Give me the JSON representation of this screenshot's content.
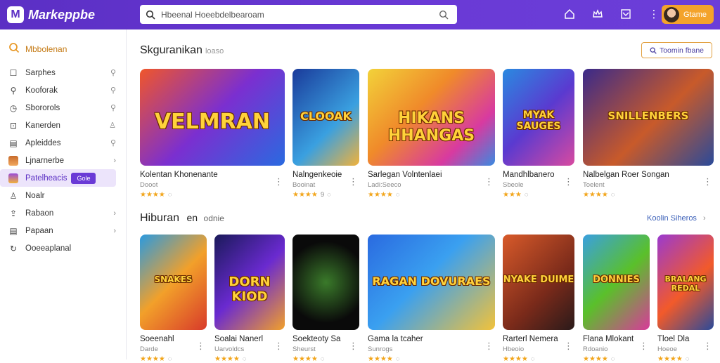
{
  "app": {
    "name": "Markeppbe"
  },
  "search": {
    "value": "Hbeenal Hoeebdelbearoam"
  },
  "header": {
    "user_label": "Gtame"
  },
  "sidebar": {
    "heading": "Mbbolenan",
    "items": [
      {
        "label": "Sarphes",
        "icon": "square-icon",
        "trailing": "pin"
      },
      {
        "label": "Kooforak",
        "icon": "bookmark-icon",
        "trailing": "pin"
      },
      {
        "label": "Sbororols",
        "icon": "clock-icon",
        "trailing": "pin"
      },
      {
        "label": "Kanerden",
        "icon": "user-box-icon",
        "trailing": "person"
      },
      {
        "label": "Apleiddes",
        "icon": "doc-icon",
        "trailing": "pin"
      },
      {
        "label": "Ljnarnerbe",
        "icon": "game-avatar-icon",
        "trailing": "chevron"
      },
      {
        "label": "Patelheacis",
        "icon": "game-avatar-icon",
        "badge": "Gole",
        "active": true
      },
      {
        "label": "Noalr",
        "icon": "person-icon"
      },
      {
        "label": "Rabaon",
        "icon": "upload-icon",
        "trailing": "chevron"
      },
      {
        "label": "Papaan",
        "icon": "doc-icon",
        "trailing": "chevron"
      },
      {
        "label": "Ooeeaplanal",
        "icon": "refresh-icon"
      }
    ]
  },
  "section1": {
    "title": "Skguranikan",
    "subtitle": "loaso",
    "action_label": "Toomin fbane",
    "cards": [
      {
        "title": "Kolentan Khonenante",
        "sub": "Dooot",
        "rating": "★★★★",
        "thumb_text": "VELMRAN"
      },
      {
        "title": "Nalngenkeoie",
        "sub": "Booinat",
        "rating": "★★★★",
        "count": "9",
        "thumb_text": "CLOOAK"
      },
      {
        "title": "Sarlegan Volntenlaei",
        "sub": "Ladi:Seeco",
        "rating": "★★★★",
        "thumb_text": "HIKANS HHANGAS"
      },
      {
        "title": "Mandhlbanero",
        "sub": "Sbeole",
        "rating": "★★★",
        "thumb_text": "MYAK SAUGES"
      },
      {
        "title": "Nalbelgan Roer Songan",
        "sub": "Toelent",
        "rating": "★★★★",
        "thumb_text": "SNILLENBERS"
      }
    ]
  },
  "section2": {
    "title": "Hiburan",
    "title_b": "en",
    "subtitle": "odnie",
    "action_label": "Koolin Siheros",
    "cards": [
      {
        "title": "Soeenahl",
        "sub": "Darde",
        "rating": "★★★★",
        "thumb_text": "SNAKES"
      },
      {
        "title": "Soalai Nanerl",
        "sub": "Uarvoldcs",
        "rating": "★★★★",
        "thumb_text": "DORN KIOD"
      },
      {
        "title": "Soekteoty Sa",
        "sub": "Sheurst",
        "rating": "★★★★",
        "thumb_text": ""
      },
      {
        "title": "Gama la tcaher",
        "sub": "Sunrogs",
        "rating": "★★★★",
        "thumb_text": "RAGAN DOVURAES"
      },
      {
        "title": "Rarterl Nemera",
        "sub": "Hbeoio",
        "rating": "★★★★",
        "thumb_text": "NYAKE DUIME"
      },
      {
        "title": "Flana Mlokant",
        "sub": "Rdoanio",
        "rating": "★★★★",
        "thumb_text": "DONNIES"
      },
      {
        "title": "Tloel Dla",
        "sub": "Hoeoe",
        "rating": "★★★★",
        "thumb_text": "BRALANG REDAL"
      }
    ]
  },
  "colors": {
    "brand": "#5b2fc4",
    "accent": "#f4a32b",
    "star": "#f2a51b"
  }
}
